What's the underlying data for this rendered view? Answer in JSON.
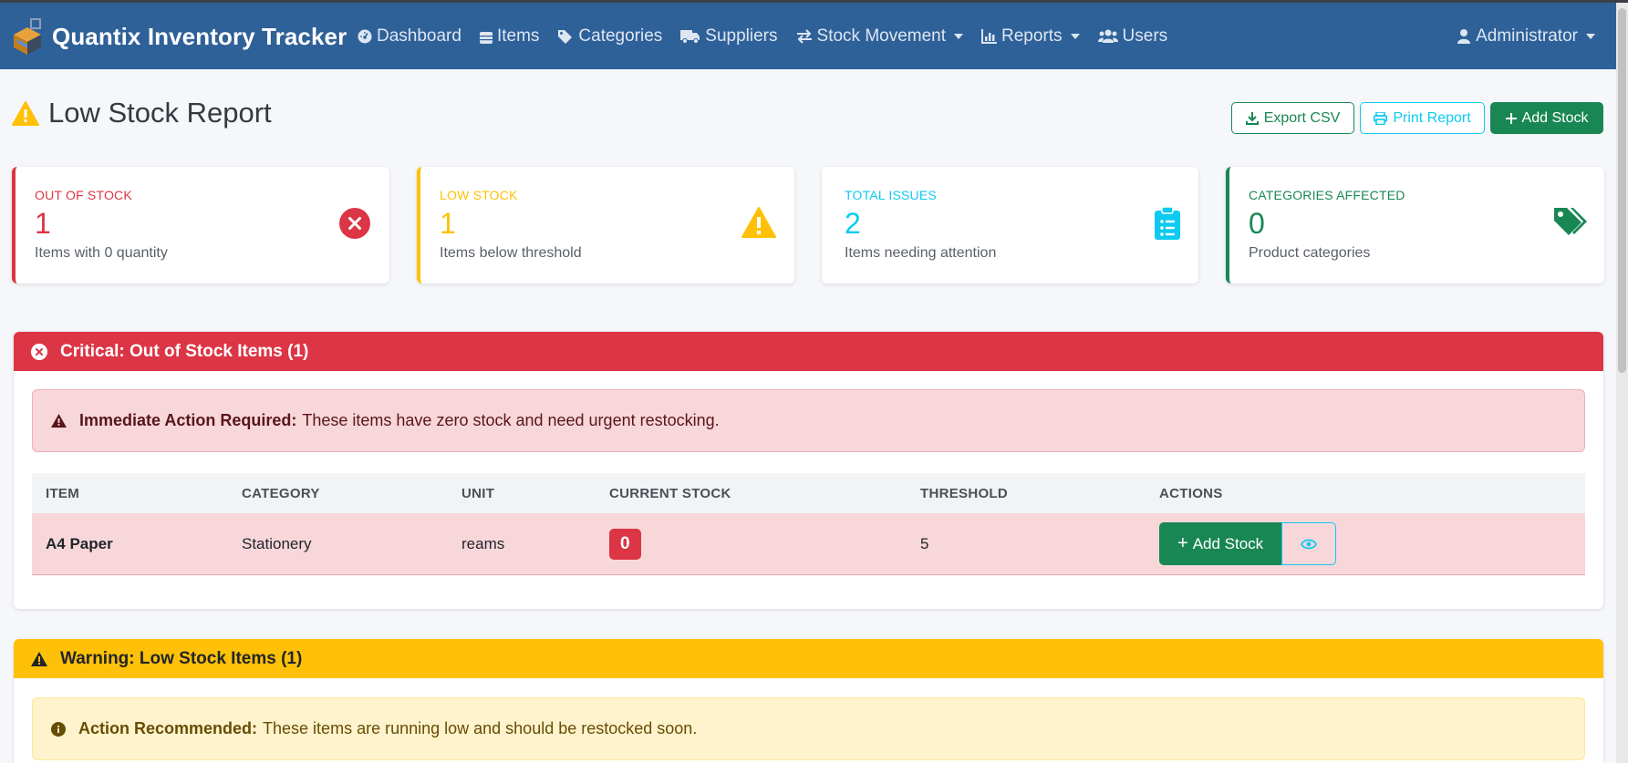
{
  "app": {
    "title": "Quantix Inventory Tracker"
  },
  "nav": {
    "items": [
      {
        "label": "Dashboard",
        "icon": "gauge-icon"
      },
      {
        "label": "Items",
        "icon": "boxes-icon"
      },
      {
        "label": "Categories",
        "icon": "tags-icon"
      },
      {
        "label": "Suppliers",
        "icon": "truck-icon"
      },
      {
        "label": "Stock Movement",
        "icon": "exchange-icon",
        "dropdown": true
      },
      {
        "label": "Reports",
        "icon": "chart-icon",
        "dropdown": true
      },
      {
        "label": "Users",
        "icon": "users-icon"
      }
    ],
    "user": "Administrator"
  },
  "page": {
    "title": "Low Stock Report"
  },
  "actions": {
    "export": "Export CSV",
    "print": "Print Report",
    "add": "Add Stock"
  },
  "stats": [
    {
      "label": "Out of Stock",
      "value": "1",
      "sub": "Items with 0 quantity",
      "color": "#dc3545",
      "icon": "times-circle-icon"
    },
    {
      "label": "Low Stock",
      "value": "1",
      "sub": "Items below threshold",
      "color": "#ffc107",
      "icon": "warning-icon"
    },
    {
      "label": "Total Issues",
      "value": "2",
      "sub": "Items needing attention",
      "color": "#0dcaf0",
      "icon": "clipboard-list-icon"
    },
    {
      "label": "Categories Affected",
      "value": "0",
      "sub": "Product categories",
      "color": "#198754",
      "icon": "tags-icon"
    }
  ],
  "critical": {
    "header": "Critical: Out of Stock Items (1)",
    "alert_bold": "Immediate Action Required:",
    "alert_text": "These items have zero stock and need urgent restocking.",
    "columns": [
      "ITEM",
      "CATEGORY",
      "UNIT",
      "CURRENT STOCK",
      "THRESHOLD",
      "ACTIONS"
    ],
    "rows": [
      {
        "item": "A4 Paper",
        "category": "Stationery",
        "unit": "reams",
        "stock": "0",
        "threshold": "5",
        "action": "Add Stock"
      }
    ]
  },
  "warning": {
    "header": "Warning: Low Stock Items (1)",
    "alert_bold": "Action Recommended:",
    "alert_text": "These items are running low and should be restocked soon."
  }
}
